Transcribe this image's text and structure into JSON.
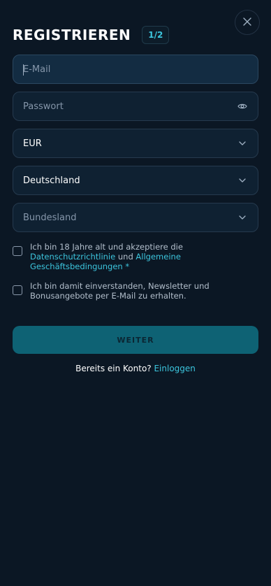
{
  "header": {
    "title": "REGISTRIEREN",
    "step": "1/2"
  },
  "fields": {
    "email_placeholder": "E-Mail",
    "password_placeholder": "Passwort",
    "currency_value": "EUR",
    "country_value": "Deutschland",
    "state_placeholder": "Bundesland"
  },
  "consent": {
    "terms_prefix": "Ich bin 18 Jahre alt und akzeptiere die ",
    "privacy_link": "Datenschutzrichtlinie",
    "terms_middle": " und ",
    "terms_link": "Allgemeine Geschäftsbedingungen",
    "required_mark": " *",
    "newsletter_text": "Ich bin damit einverstanden, Newsletter und Bonusangebote per E-Mail zu erhalten."
  },
  "actions": {
    "submit_label": "WEITER",
    "login_prompt": "Bereits ein Konto? ",
    "login_link": "Einloggen"
  },
  "icons": {
    "close": "close-icon",
    "eye": "eye-icon",
    "chevron": "chevron-down-icon"
  },
  "colors": {
    "background": "#0b1724",
    "accent": "#3cc5dd",
    "button": "#0e6274"
  }
}
